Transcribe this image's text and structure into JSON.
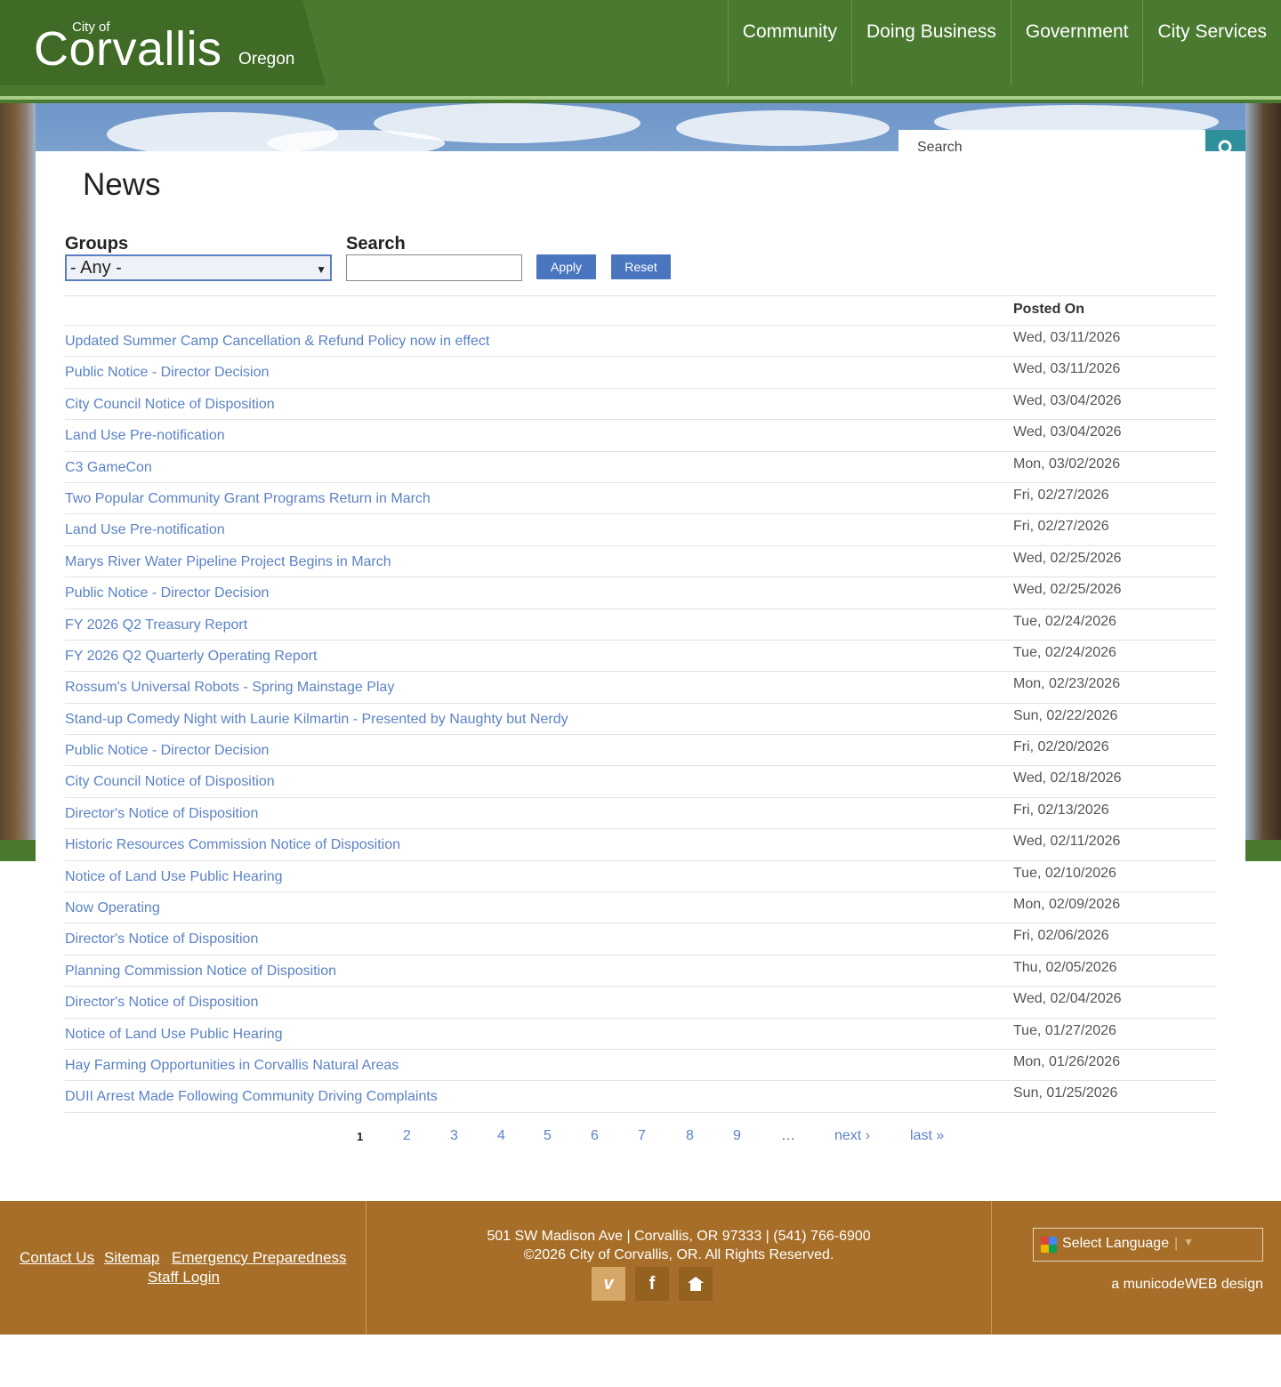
{
  "header": {
    "logo_city_of": "City of",
    "logo_name": "Corvallis",
    "logo_state": "Oregon",
    "nav": [
      "Community",
      "Doing Business",
      "Government",
      "City Services"
    ]
  },
  "site_search": {
    "placeholder": "Search"
  },
  "page": {
    "title": "News",
    "filters": {
      "groups_label": "Groups",
      "groups_selected": "- Any -",
      "search_label": "Search",
      "apply_label": "Apply",
      "reset_label": "Reset"
    },
    "table": {
      "header_posted_on": "Posted On",
      "rows": [
        {
          "title": "Updated Summer Camp Cancellation & Refund Policy now in effect",
          "date": "Wed, 03/11/2026"
        },
        {
          "title": "Public Notice - Director Decision",
          "date": "Wed, 03/11/2026"
        },
        {
          "title": "City Council Notice of Disposition",
          "date": "Wed, 03/04/2026"
        },
        {
          "title": "Land Use Pre-notification",
          "date": "Wed, 03/04/2026"
        },
        {
          "title": "C3 GameCon",
          "date": "Mon, 03/02/2026"
        },
        {
          "title": "Two Popular Community Grant Programs Return in March",
          "date": "Fri, 02/27/2026"
        },
        {
          "title": "Land Use Pre-notification",
          "date": "Fri, 02/27/2026"
        },
        {
          "title": "Marys River Water Pipeline Project Begins in March",
          "date": "Wed, 02/25/2026"
        },
        {
          "title": "Public Notice - Director Decision",
          "date": "Wed, 02/25/2026"
        },
        {
          "title": "FY 2026 Q2 Treasury Report",
          "date": "Tue, 02/24/2026"
        },
        {
          "title": "FY 2026 Q2 Quarterly Operating Report",
          "date": "Tue, 02/24/2026"
        },
        {
          "title": "Rossum's Universal Robots - Spring Mainstage Play",
          "date": "Mon, 02/23/2026"
        },
        {
          "title": "Stand-up Comedy Night with Laurie Kilmartin - Presented by Naughty but Nerdy",
          "date": "Sun, 02/22/2026"
        },
        {
          "title": "Public Notice - Director Decision",
          "date": "Fri, 02/20/2026"
        },
        {
          "title": "City Council Notice of Disposition",
          "date": "Wed, 02/18/2026"
        },
        {
          "title": "Director's Notice of Disposition",
          "date": "Fri, 02/13/2026"
        },
        {
          "title": "Historic Resources Commission Notice of Disposition",
          "date": "Wed, 02/11/2026"
        },
        {
          "title": "Notice of Land Use Public Hearing",
          "date": "Tue, 02/10/2026"
        },
        {
          "title": "Now Operating",
          "date": "Mon, 02/09/2026"
        },
        {
          "title": "Director's Notice of Disposition",
          "date": "Fri, 02/06/2026"
        },
        {
          "title": "Planning Commission Notice of Disposition",
          "date": "Thu, 02/05/2026"
        },
        {
          "title": "Director's Notice of Disposition",
          "date": "Wed, 02/04/2026"
        },
        {
          "title": "Notice of Land Use Public Hearing",
          "date": "Tue, 01/27/2026"
        },
        {
          "title": "Hay Farming Opportunities in Corvallis Natural Areas",
          "date": "Mon, 01/26/2026"
        },
        {
          "title": "DUII Arrest Made Following Community Driving Complaints",
          "date": "Sun, 01/25/2026"
        }
      ]
    },
    "pager": {
      "current": "1",
      "pages": [
        "2",
        "3",
        "4",
        "5",
        "6",
        "7",
        "8",
        "9"
      ],
      "ellipsis": "…",
      "next": "next ›",
      "last": "last »"
    }
  },
  "footer": {
    "links": [
      "Contact Us",
      "Sitemap",
      "Emergency Preparedness"
    ],
    "staff_login": "Staff Login",
    "address": "501 SW Madison Ave | Corvallis, OR 97333 | (541) 766-6900",
    "copyright": "©2026 City of Corvallis, OR. All Rights Reserved.",
    "social_icons": [
      "vimeo-icon",
      "facebook-icon",
      "nextdoor-icon"
    ],
    "select_language": "Select Language",
    "credit": "a municodeWEB design"
  },
  "colors": {
    "header_green": "#4a7a30",
    "link_blue": "#5b82c6",
    "button_blue": "#4a76c0",
    "footer_brown": "#a66e28",
    "search_teal": "#2f8f9a"
  }
}
